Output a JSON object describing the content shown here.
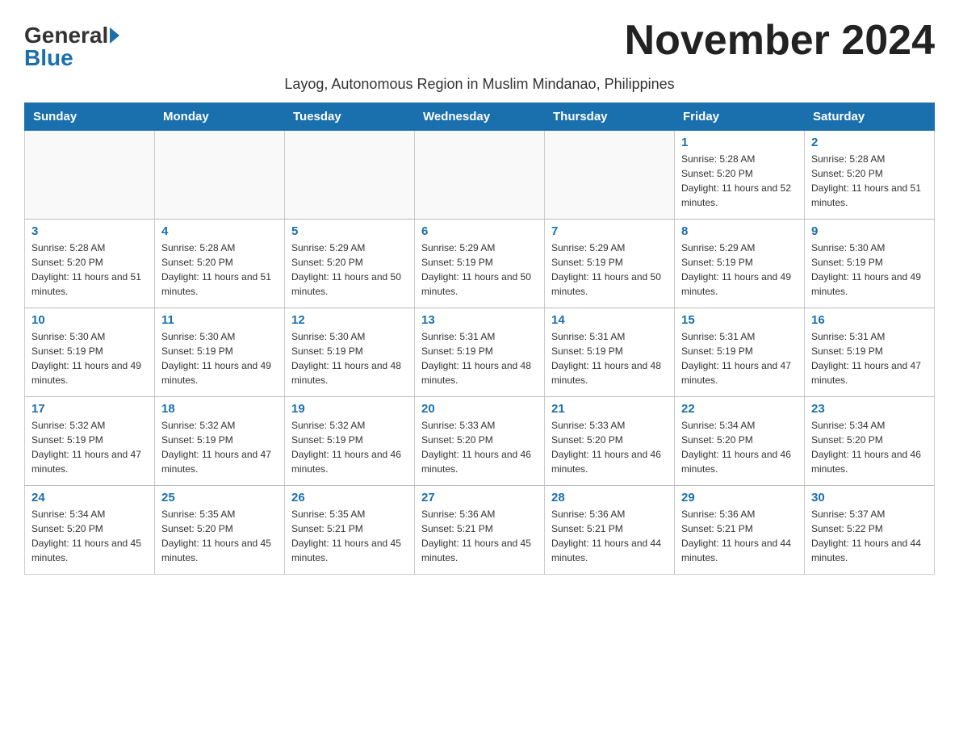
{
  "header": {
    "logo_general": "General",
    "logo_blue": "Blue",
    "month_title": "November 2024",
    "subtitle": "Layog, Autonomous Region in Muslim Mindanao, Philippines"
  },
  "weekdays": [
    "Sunday",
    "Monday",
    "Tuesday",
    "Wednesday",
    "Thursday",
    "Friday",
    "Saturday"
  ],
  "weeks": [
    [
      {
        "day": "",
        "sunrise": "",
        "sunset": "",
        "daylight": ""
      },
      {
        "day": "",
        "sunrise": "",
        "sunset": "",
        "daylight": ""
      },
      {
        "day": "",
        "sunrise": "",
        "sunset": "",
        "daylight": ""
      },
      {
        "day": "",
        "sunrise": "",
        "sunset": "",
        "daylight": ""
      },
      {
        "day": "",
        "sunrise": "",
        "sunset": "",
        "daylight": ""
      },
      {
        "day": "1",
        "sunrise": "Sunrise: 5:28 AM",
        "sunset": "Sunset: 5:20 PM",
        "daylight": "Daylight: 11 hours and 52 minutes."
      },
      {
        "day": "2",
        "sunrise": "Sunrise: 5:28 AM",
        "sunset": "Sunset: 5:20 PM",
        "daylight": "Daylight: 11 hours and 51 minutes."
      }
    ],
    [
      {
        "day": "3",
        "sunrise": "Sunrise: 5:28 AM",
        "sunset": "Sunset: 5:20 PM",
        "daylight": "Daylight: 11 hours and 51 minutes."
      },
      {
        "day": "4",
        "sunrise": "Sunrise: 5:28 AM",
        "sunset": "Sunset: 5:20 PM",
        "daylight": "Daylight: 11 hours and 51 minutes."
      },
      {
        "day": "5",
        "sunrise": "Sunrise: 5:29 AM",
        "sunset": "Sunset: 5:20 PM",
        "daylight": "Daylight: 11 hours and 50 minutes."
      },
      {
        "day": "6",
        "sunrise": "Sunrise: 5:29 AM",
        "sunset": "Sunset: 5:19 PM",
        "daylight": "Daylight: 11 hours and 50 minutes."
      },
      {
        "day": "7",
        "sunrise": "Sunrise: 5:29 AM",
        "sunset": "Sunset: 5:19 PM",
        "daylight": "Daylight: 11 hours and 50 minutes."
      },
      {
        "day": "8",
        "sunrise": "Sunrise: 5:29 AM",
        "sunset": "Sunset: 5:19 PM",
        "daylight": "Daylight: 11 hours and 49 minutes."
      },
      {
        "day": "9",
        "sunrise": "Sunrise: 5:30 AM",
        "sunset": "Sunset: 5:19 PM",
        "daylight": "Daylight: 11 hours and 49 minutes."
      }
    ],
    [
      {
        "day": "10",
        "sunrise": "Sunrise: 5:30 AM",
        "sunset": "Sunset: 5:19 PM",
        "daylight": "Daylight: 11 hours and 49 minutes."
      },
      {
        "day": "11",
        "sunrise": "Sunrise: 5:30 AM",
        "sunset": "Sunset: 5:19 PM",
        "daylight": "Daylight: 11 hours and 49 minutes."
      },
      {
        "day": "12",
        "sunrise": "Sunrise: 5:30 AM",
        "sunset": "Sunset: 5:19 PM",
        "daylight": "Daylight: 11 hours and 48 minutes."
      },
      {
        "day": "13",
        "sunrise": "Sunrise: 5:31 AM",
        "sunset": "Sunset: 5:19 PM",
        "daylight": "Daylight: 11 hours and 48 minutes."
      },
      {
        "day": "14",
        "sunrise": "Sunrise: 5:31 AM",
        "sunset": "Sunset: 5:19 PM",
        "daylight": "Daylight: 11 hours and 48 minutes."
      },
      {
        "day": "15",
        "sunrise": "Sunrise: 5:31 AM",
        "sunset": "Sunset: 5:19 PM",
        "daylight": "Daylight: 11 hours and 47 minutes."
      },
      {
        "day": "16",
        "sunrise": "Sunrise: 5:31 AM",
        "sunset": "Sunset: 5:19 PM",
        "daylight": "Daylight: 11 hours and 47 minutes."
      }
    ],
    [
      {
        "day": "17",
        "sunrise": "Sunrise: 5:32 AM",
        "sunset": "Sunset: 5:19 PM",
        "daylight": "Daylight: 11 hours and 47 minutes."
      },
      {
        "day": "18",
        "sunrise": "Sunrise: 5:32 AM",
        "sunset": "Sunset: 5:19 PM",
        "daylight": "Daylight: 11 hours and 47 minutes."
      },
      {
        "day": "19",
        "sunrise": "Sunrise: 5:32 AM",
        "sunset": "Sunset: 5:19 PM",
        "daylight": "Daylight: 11 hours and 46 minutes."
      },
      {
        "day": "20",
        "sunrise": "Sunrise: 5:33 AM",
        "sunset": "Sunset: 5:20 PM",
        "daylight": "Daylight: 11 hours and 46 minutes."
      },
      {
        "day": "21",
        "sunrise": "Sunrise: 5:33 AM",
        "sunset": "Sunset: 5:20 PM",
        "daylight": "Daylight: 11 hours and 46 minutes."
      },
      {
        "day": "22",
        "sunrise": "Sunrise: 5:34 AM",
        "sunset": "Sunset: 5:20 PM",
        "daylight": "Daylight: 11 hours and 46 minutes."
      },
      {
        "day": "23",
        "sunrise": "Sunrise: 5:34 AM",
        "sunset": "Sunset: 5:20 PM",
        "daylight": "Daylight: 11 hours and 46 minutes."
      }
    ],
    [
      {
        "day": "24",
        "sunrise": "Sunrise: 5:34 AM",
        "sunset": "Sunset: 5:20 PM",
        "daylight": "Daylight: 11 hours and 45 minutes."
      },
      {
        "day": "25",
        "sunrise": "Sunrise: 5:35 AM",
        "sunset": "Sunset: 5:20 PM",
        "daylight": "Daylight: 11 hours and 45 minutes."
      },
      {
        "day": "26",
        "sunrise": "Sunrise: 5:35 AM",
        "sunset": "Sunset: 5:21 PM",
        "daylight": "Daylight: 11 hours and 45 minutes."
      },
      {
        "day": "27",
        "sunrise": "Sunrise: 5:36 AM",
        "sunset": "Sunset: 5:21 PM",
        "daylight": "Daylight: 11 hours and 45 minutes."
      },
      {
        "day": "28",
        "sunrise": "Sunrise: 5:36 AM",
        "sunset": "Sunset: 5:21 PM",
        "daylight": "Daylight: 11 hours and 44 minutes."
      },
      {
        "day": "29",
        "sunrise": "Sunrise: 5:36 AM",
        "sunset": "Sunset: 5:21 PM",
        "daylight": "Daylight: 11 hours and 44 minutes."
      },
      {
        "day": "30",
        "sunrise": "Sunrise: 5:37 AM",
        "sunset": "Sunset: 5:22 PM",
        "daylight": "Daylight: 11 hours and 44 minutes."
      }
    ]
  ]
}
